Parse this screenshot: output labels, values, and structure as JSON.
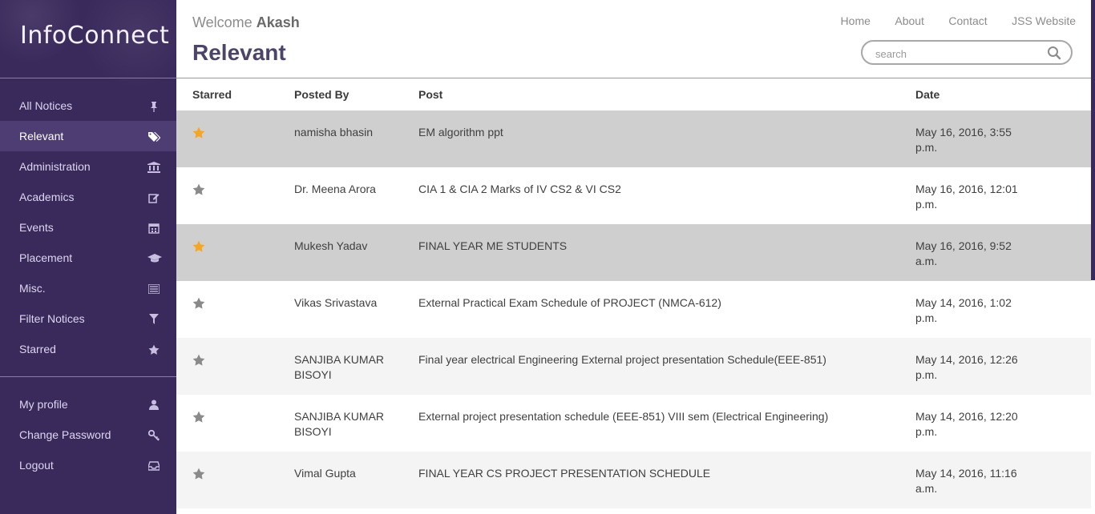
{
  "sidebar": {
    "logo": "InfoConnect",
    "items": [
      {
        "label": "All Notices",
        "icon": "pin-icon"
      },
      {
        "label": "Relevant",
        "icon": "tags-icon",
        "active": true
      },
      {
        "label": "Administration",
        "icon": "institution-icon"
      },
      {
        "label": "Academics",
        "icon": "edit-icon"
      },
      {
        "label": "Events",
        "icon": "calendar-icon"
      },
      {
        "label": "Placement",
        "icon": "graduation-cap-icon"
      },
      {
        "label": "Misc.",
        "icon": "list-icon"
      },
      {
        "label": "Filter Notices",
        "icon": "filter-icon"
      },
      {
        "label": "Starred",
        "icon": "star-icon"
      }
    ],
    "account": [
      {
        "label": "My profile",
        "icon": "user-icon"
      },
      {
        "label": "Change Password",
        "icon": "key-icon"
      },
      {
        "label": "Logout",
        "icon": "inbox-icon"
      }
    ]
  },
  "header": {
    "welcome_prefix": "Welcome",
    "user": "Akash",
    "title": "Relevant",
    "nav": [
      "Home",
      "About",
      "Contact",
      "JSS Website"
    ],
    "search_placeholder": "search"
  },
  "table": {
    "columns": [
      "Starred",
      "Posted By",
      "Post",
      "Date"
    ],
    "rows": [
      {
        "starred": true,
        "by": "namisha bhasin",
        "post": "EM algorithm ppt",
        "date": "May 16, 2016, 3:55 p.m."
      },
      {
        "starred": false,
        "by": "Dr. Meena Arora",
        "post": "CIA 1 & CIA 2 Marks of IV CS2 & VI CS2",
        "date": "May 16, 2016, 12:01 p.m."
      },
      {
        "starred": true,
        "by": "Mukesh Yadav",
        "post": "FINAL YEAR ME STUDENTS",
        "date": "May 16, 2016, 9:52 a.m."
      },
      {
        "starred": false,
        "by": "Vikas Srivastava",
        "post": "External Practical Exam Schedule of PROJECT (NMCA-612)",
        "date": "May 14, 2016, 1:02 p.m."
      },
      {
        "starred": false,
        "by": "SANJIBA KUMAR BISOYI",
        "post": "Final year electrical Engineering External project presentation Schedule(EEE-851)",
        "date": "May 14, 2016, 12:26 p.m."
      },
      {
        "starred": false,
        "by": "SANJIBA KUMAR BISOYI",
        "post": "External project presentation schedule (EEE-851) VIII sem (Electrical Engineering)",
        "date": "May 14, 2016, 12:20 p.m."
      },
      {
        "starred": false,
        "by": "Vimal Gupta",
        "post": "FINAL YEAR CS PROJECT PRESENTATION SCHEDULE",
        "date": "May 14, 2016, 11:16 a.m."
      }
    ]
  },
  "colors": {
    "sidebar_bg": "#3a2a5c",
    "sidebar_active": "#4d3d72",
    "star_on": "#f5a623",
    "star_off": "#8a8a8a",
    "row_highlight": "#cfcfcf"
  }
}
